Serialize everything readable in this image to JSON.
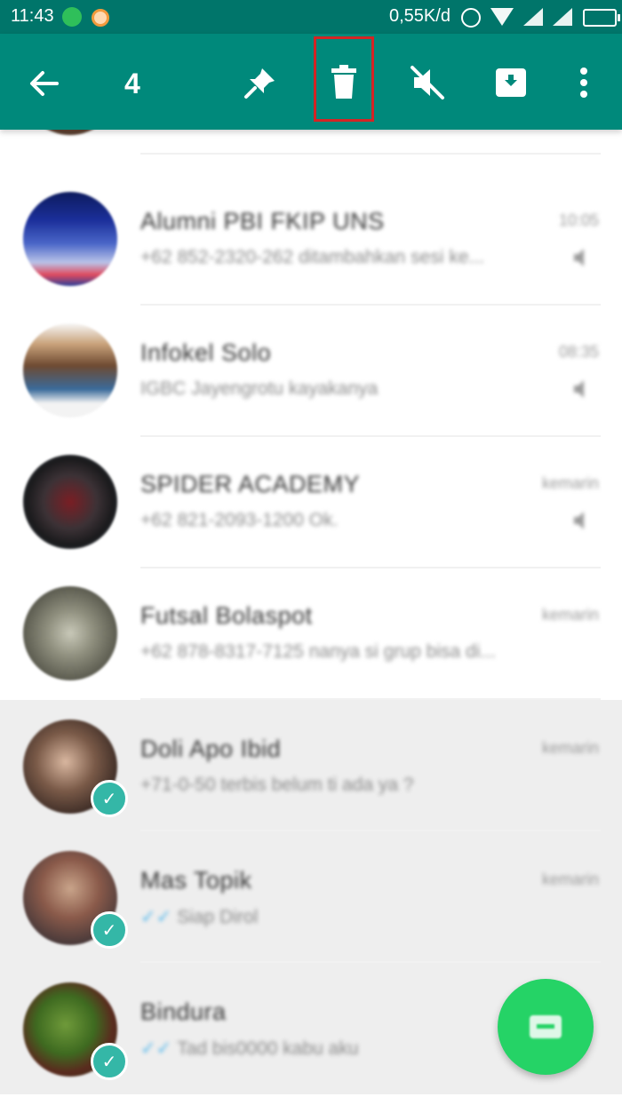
{
  "status_bar": {
    "time": "11:43",
    "net_speed": "0,55K/d",
    "icons": [
      "whatsapp-notification-icon",
      "app-notification-icon",
      "alarm-icon",
      "wifi-icon",
      "signal-icon",
      "signal-icon",
      "battery-icon"
    ]
  },
  "action_bar": {
    "selected_count": "4",
    "back_icon": "arrow-left-icon",
    "actions": [
      {
        "name": "pin",
        "icon": "pin-icon"
      },
      {
        "name": "delete",
        "icon": "trash-icon",
        "highlighted": true
      },
      {
        "name": "mute",
        "icon": "mute-icon"
      },
      {
        "name": "archive",
        "icon": "archive-icon"
      },
      {
        "name": "more",
        "icon": "more-vert-icon"
      }
    ],
    "highlight_color": "#d42424"
  },
  "colors": {
    "status_bar": "#00756a",
    "action_bar": "#00897b",
    "selected_row": "#eeeeee",
    "fab": "#25d366",
    "check": "#34b7a7"
  },
  "chats": [
    {
      "name": "Alumni PBI FKIP UNS",
      "preview": "+62 852-2320-262 ditambahkan sesi ke...",
      "time": "10:05",
      "selected": false,
      "muted": true
    },
    {
      "name": "Infokel Solo",
      "preview": "IGBC Jayengrotu kayakanya",
      "time": "08:35",
      "selected": false,
      "muted": true
    },
    {
      "name": "SPIDER ACADEMY",
      "preview": "+62 821-2093-1200 Ok.",
      "time": "kemarin",
      "selected": false,
      "muted": true
    },
    {
      "name": "Futsal Bolaspot",
      "preview": "+62 878-8317-7125 nanya si grup bisa di...",
      "time": "kemarin",
      "selected": false,
      "muted": false
    },
    {
      "name": "Doli Apo Ibid",
      "preview": "+71-0-50 terbis belum ti ada ya ?",
      "time": "kemarin",
      "selected": true,
      "muted": false
    },
    {
      "name": "Mas Topik",
      "preview": "Siap Dirol",
      "time": "kemarin",
      "selected": true,
      "muted": false,
      "ticks": true
    },
    {
      "name": "Bindura",
      "preview": "Tad bis0000 kabu aku",
      "time": "",
      "selected": true,
      "muted": false,
      "ticks": true
    }
  ],
  "fab": {
    "icon": "new-chat-icon"
  }
}
